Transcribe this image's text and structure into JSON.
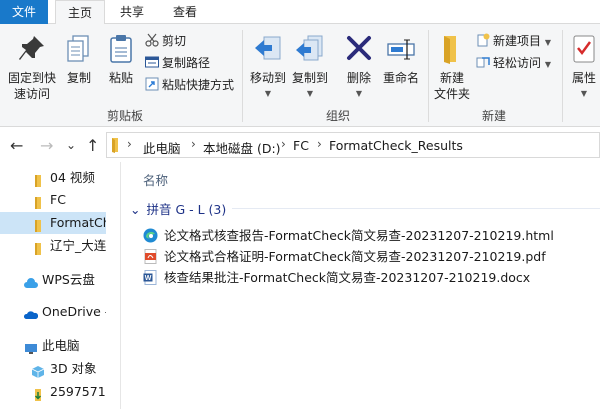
{
  "tabs": {
    "file": "文件",
    "home": "主页",
    "share": "共享",
    "view": "查看"
  },
  "ribbon": {
    "clipboard": {
      "pin_line1": "固定到快",
      "pin_line2": "速访问",
      "copy": "复制",
      "paste": "粘贴",
      "cut": "剪切",
      "copy_path": "复制路径",
      "paste_shortcut": "粘贴快捷方式",
      "label": "剪贴板"
    },
    "organize": {
      "move_to": "移动到",
      "copy_to": "复制到",
      "delete": "删除",
      "rename": "重命名",
      "label": "组织"
    },
    "new": {
      "new_folder_line1": "新建",
      "new_folder_line2": "文件夹",
      "new_item": "新建项目",
      "easy_access": "轻松访问",
      "label": "新建"
    },
    "open": {
      "properties": "属性"
    }
  },
  "nav": {
    "back": "←",
    "forward": "→",
    "recent": "⌄",
    "up": "↑"
  },
  "address": {
    "crumbs": [
      "此电脑",
      "本地磁盘 (D:)",
      "FC",
      "FormatCheck_Results"
    ]
  },
  "navpane": {
    "items": [
      {
        "label": "04 视频"
      },
      {
        "label": "FC"
      },
      {
        "label": "FormatCheck_Results"
      },
      {
        "label": "辽宁_大连"
      },
      {
        "label": "WPS云盘"
      },
      {
        "label": "OneDrive - Personal"
      },
      {
        "label": "此电脑"
      },
      {
        "label": "3D 对象"
      },
      {
        "label": "2597571"
      }
    ]
  },
  "content": {
    "column_name": "名称",
    "group_header": "拼音 G - L (3)",
    "files": [
      {
        "name": "论文格式核查报告-FormatCheck简文易查-20231207-210219.html",
        "icon": "edge-html-icon"
      },
      {
        "name": "论文格式合格证明-FormatCheck简文易查-20231207-210219.pdf",
        "icon": "pdf-icon"
      },
      {
        "name": "核查结果批注-FormatCheck简文易查-20231207-210219.docx",
        "icon": "word-doc-icon"
      }
    ]
  },
  "colors": {
    "accent": "#1979ca",
    "selection": "#cce4f7",
    "group_text": "#1e3287",
    "folder": "#f0c24a"
  }
}
